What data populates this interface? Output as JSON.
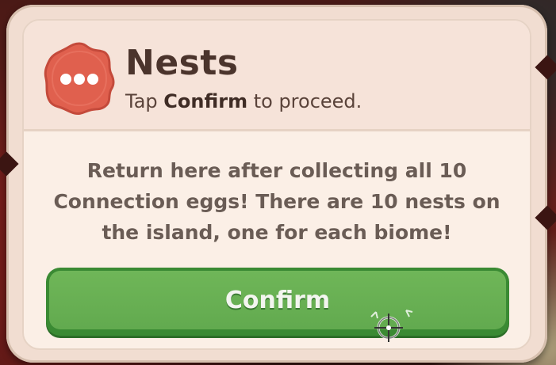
{
  "dialog": {
    "title": "Nests",
    "subtitle_prefix": "Tap ",
    "subtitle_strong": "Confirm",
    "subtitle_suffix": " to proceed.",
    "message": "Return here after collecting all 10 Connection eggs! There are 10 nests on the island, one for each biome!",
    "badge_icon": "ellipsis-icon",
    "confirm_label": "Confirm"
  },
  "colors": {
    "panel": "#fbefe6",
    "header": "#f6e3d9",
    "badge": "#e0604e",
    "button": "#62aa4f",
    "text_dark": "#4b342c",
    "text_body": "#6a5c55"
  }
}
